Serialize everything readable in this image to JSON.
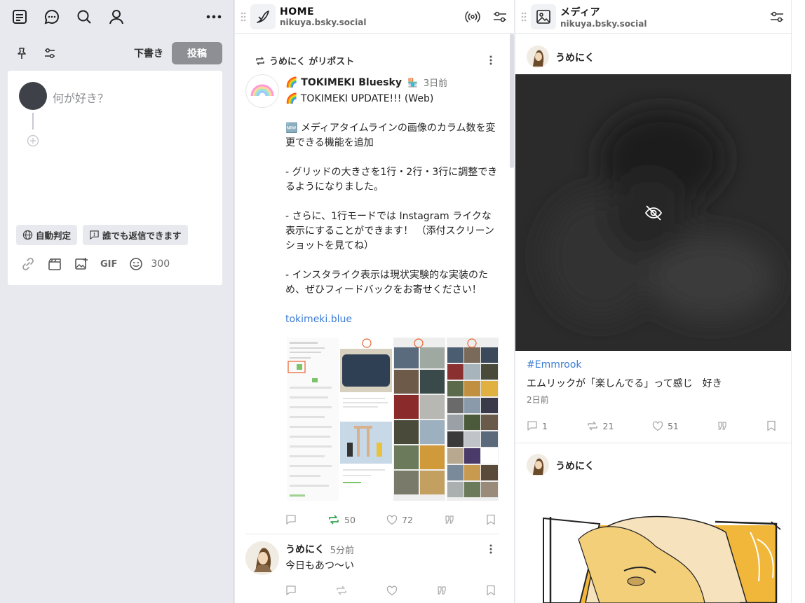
{
  "composer": {
    "draft_label": "下書き",
    "post_label": "投稿",
    "placeholder": "何が好き？",
    "lang_chip": "自動判定",
    "reply_chip": "誰でも返信できます",
    "char_count": "300",
    "gif_label": "GIF"
  },
  "home": {
    "title": "HOME",
    "handle": "nikuya.bsky.social",
    "repost_label": "うめにく がリポスト",
    "post1": {
      "author": "🌈 TOKIMEKI Bluesky",
      "time": "3日前",
      "lines": [
        "🌈 TOKIMEKI UPDATE!!! (Web)",
        "🆕 メディアタイムラインの画像のカラム数を変更できる機能を追加",
        "- グリッドの大きさを1行・2行・3行に調整できるようになりました。",
        "- さらに、1行モードでは Instagram ライクな表示にすることができます！ （添付スクリーンショットを見てね）",
        "- インスタライク表示は現状実験的な実装のため、ぜひフィードバックをお寄せください！"
      ],
      "link": "tokimeki.blue",
      "reposts": "50",
      "likes": "72"
    },
    "post2": {
      "author": "うめにく",
      "time": "5分前",
      "text": "今日もあつ〜い"
    }
  },
  "media": {
    "title": "メディア",
    "handle": "nikuya.bsky.social",
    "post1": {
      "author": "うめにく",
      "hashtag": "#Emmrook",
      "text": "エムリックが「楽しんでる」って感じ　好き",
      "time": "2日前",
      "replies": "1",
      "reposts": "21",
      "likes": "51"
    },
    "post2": {
      "author": "うめにく"
    }
  },
  "colors": {
    "accent_link": "#3a7bd5",
    "repost_green": "#2ea44f",
    "post_button": "#8e8f94",
    "sensitive_bg": "#2b2b2b"
  }
}
